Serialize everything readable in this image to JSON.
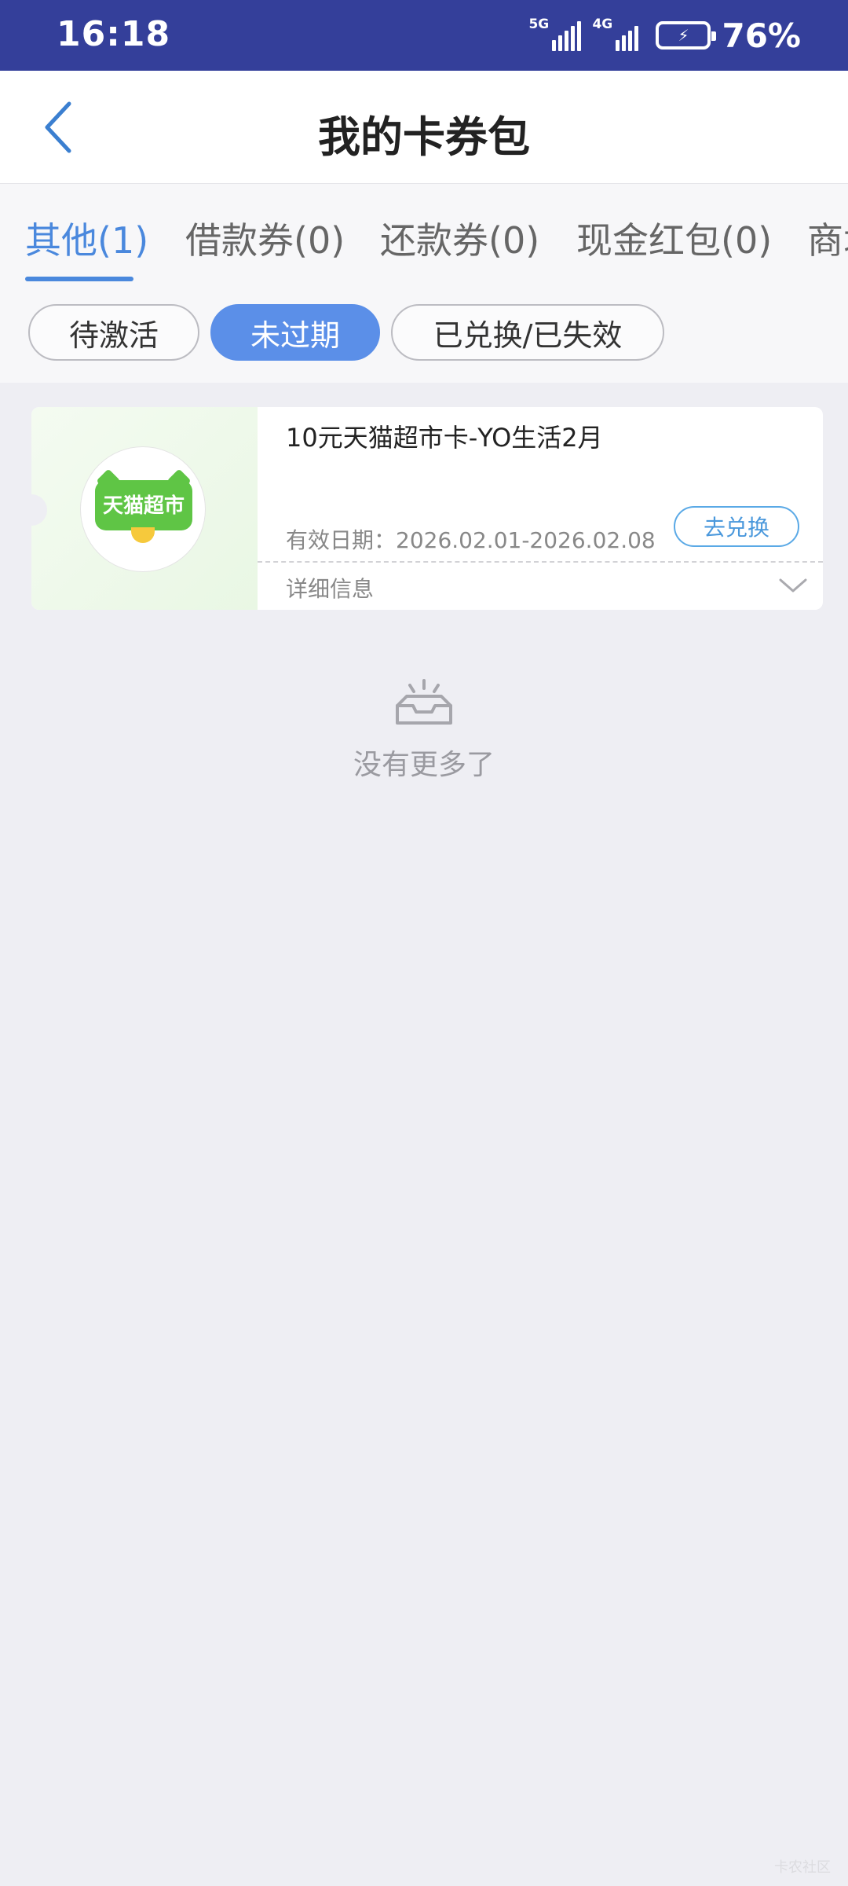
{
  "status_bar": {
    "time": "16:18",
    "network_1": "5G",
    "network_2": "4G",
    "battery_percent": "76%"
  },
  "header": {
    "title": "我的卡券包",
    "back_icon": "chevron-left-icon"
  },
  "tabs": [
    {
      "label": "其他(1)",
      "active": true
    },
    {
      "label": "借款券(0)",
      "active": false
    },
    {
      "label": "还款券(0)",
      "active": false
    },
    {
      "label": "现金红包(0)",
      "active": false
    },
    {
      "label": "商城",
      "active": false
    }
  ],
  "filters": [
    {
      "label": "待激活",
      "active": false
    },
    {
      "label": "未过期",
      "active": true
    },
    {
      "label": "已兑换/已失效",
      "active": false
    }
  ],
  "coupon": {
    "logo_text": "天猫超市",
    "title": "10元天猫超市卡-YO生活2月",
    "validity": "有效日期：2026.02.01-2026.02.08",
    "redeem_label": "去兑换",
    "detail_label": "详细信息",
    "detail_icon": "chevron-down-icon"
  },
  "empty_state": {
    "icon": "empty-tray-icon",
    "text": "没有更多了"
  },
  "watermark": "卡农社区",
  "colors": {
    "status_bar": "#343f9a",
    "accent": "#4a88dd",
    "chip_active": "#5b8fe8",
    "brand_green": "#5fc545",
    "redeem": "#4a98dc"
  }
}
